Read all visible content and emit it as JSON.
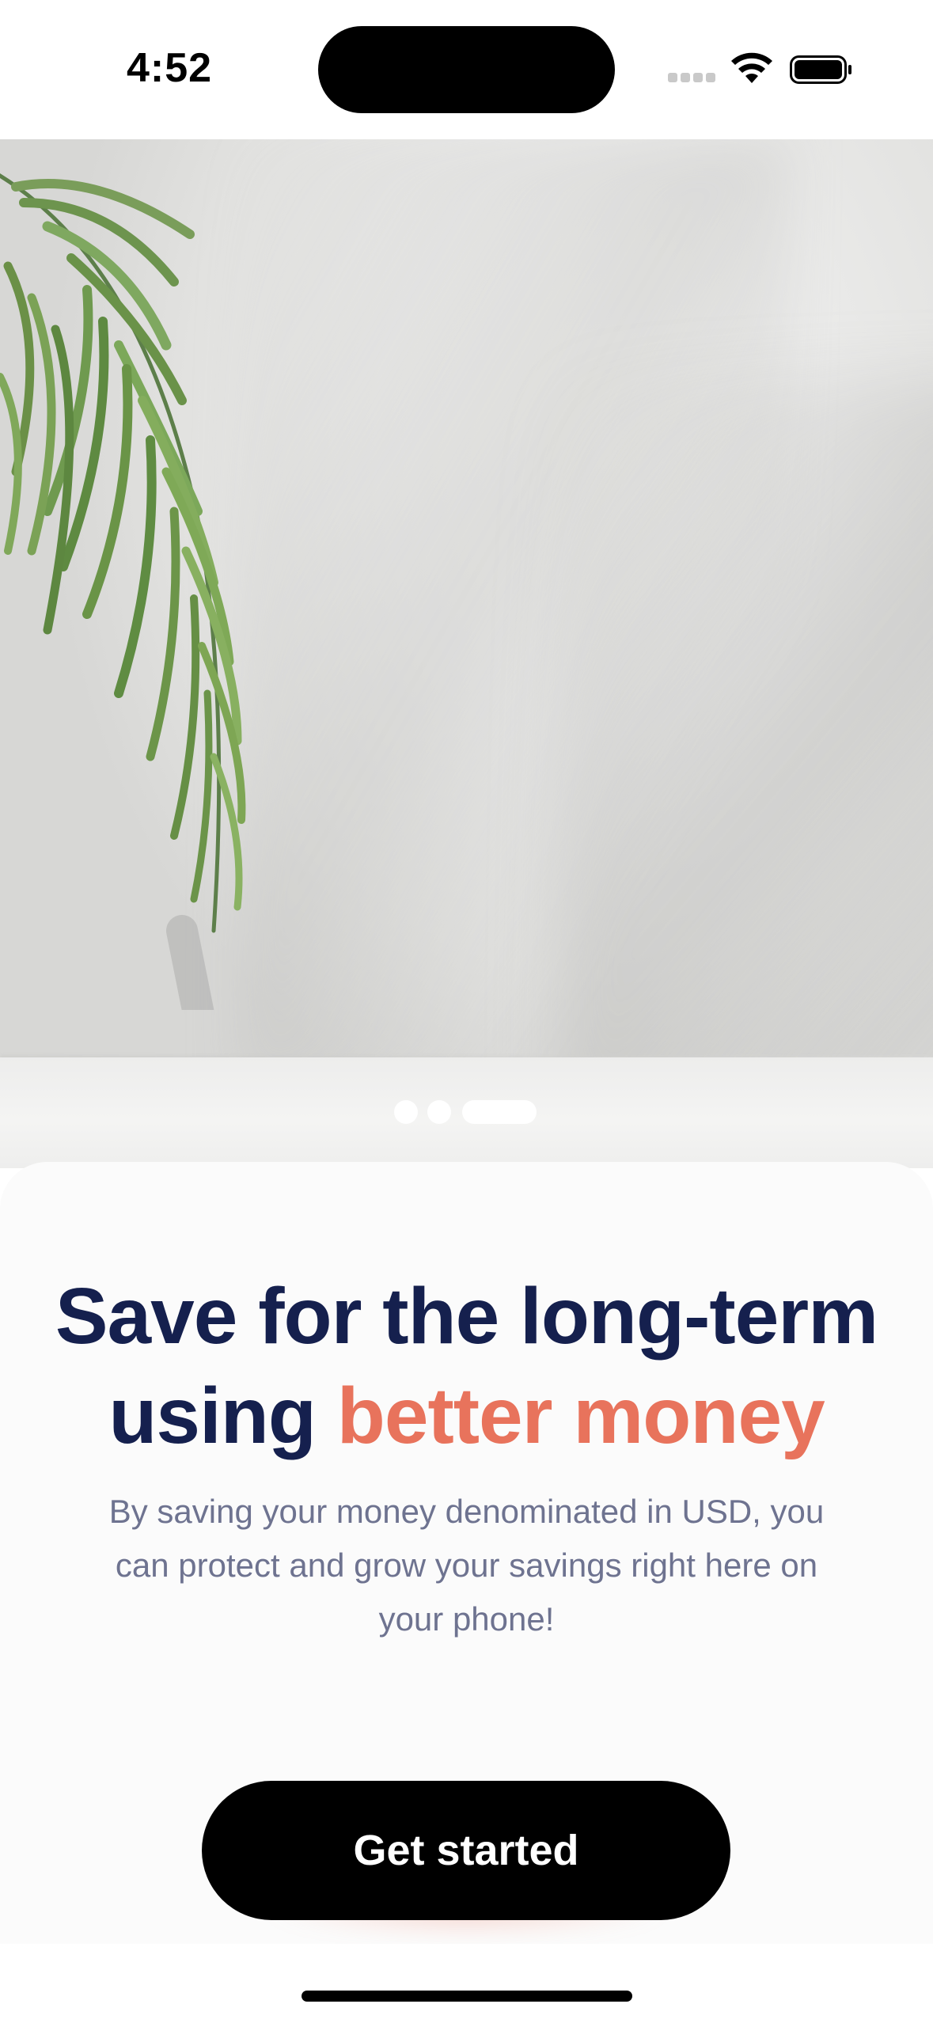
{
  "status_bar": {
    "time": "4:52"
  },
  "hero": {
    "image": "palm-leaf-against-textured-wall",
    "carousel": {
      "total": 3,
      "active_index": 2
    }
  },
  "onboarding": {
    "headline_part1": "Save for the long-term",
    "headline_part2": "using ",
    "headline_accent": "better money",
    "description": "By saving your money denominated in USD, you can protect and grow your savings right here on your phone!",
    "cta_label": "Get started"
  },
  "colors": {
    "headline": "#15204e",
    "accent": "#e8735c",
    "body_text": "#6e7390",
    "button": "#000000"
  }
}
